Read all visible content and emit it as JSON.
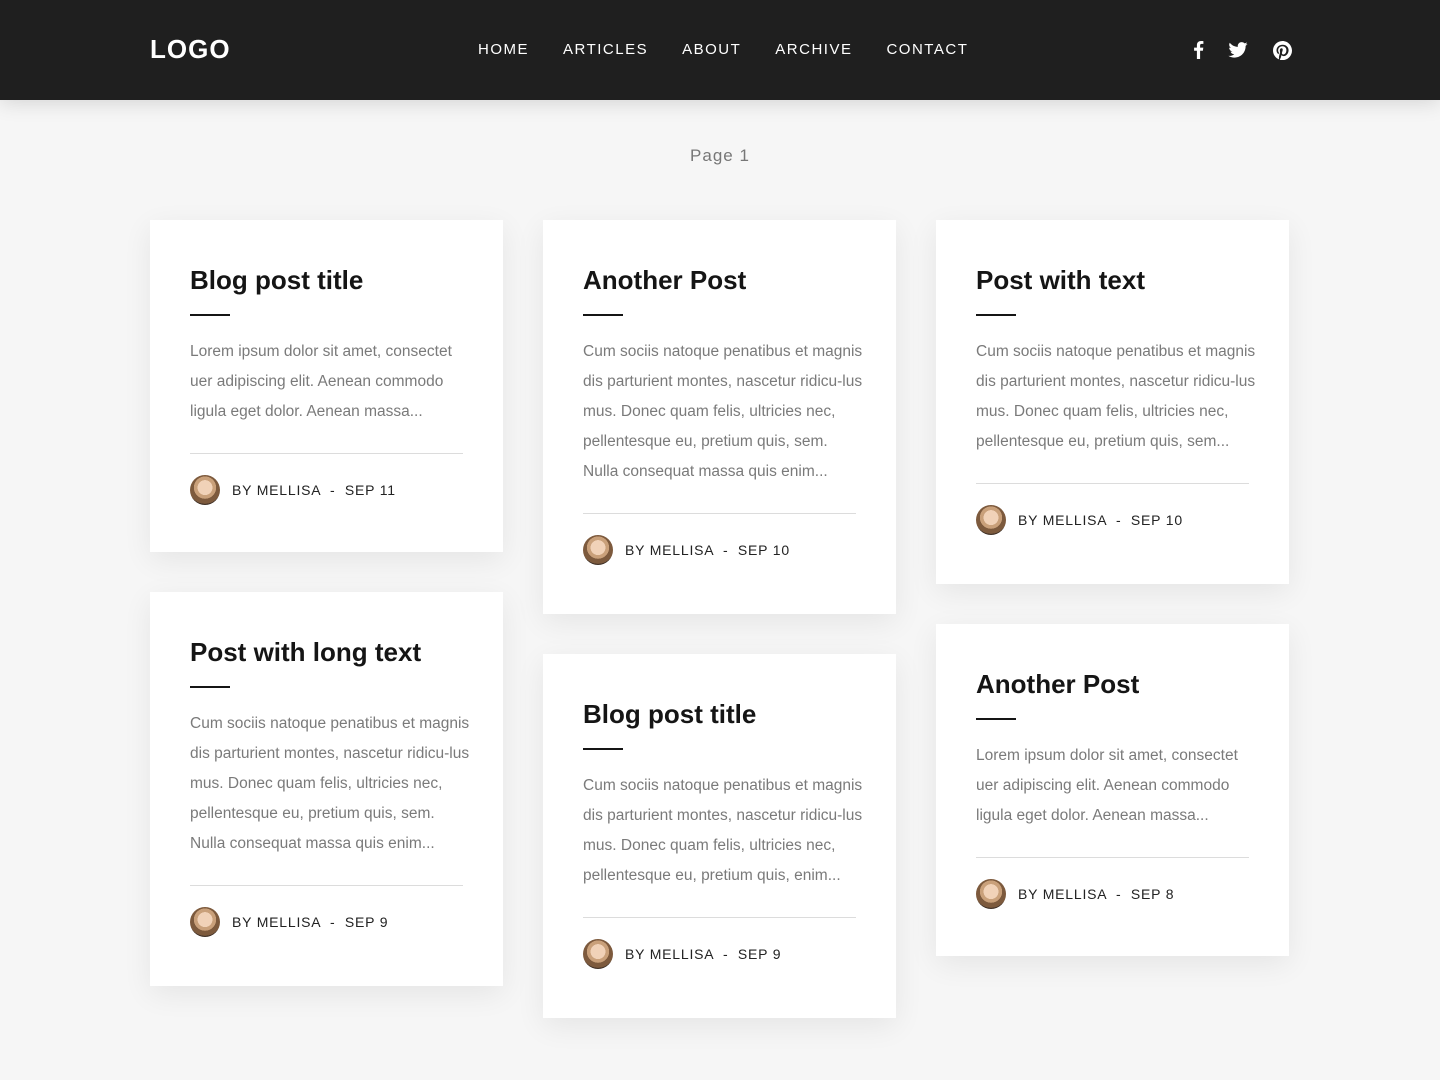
{
  "header": {
    "logo": "LOGO",
    "nav": [
      "HOME",
      "ARTICLES",
      "ABOUT",
      "ARCHIVE",
      "CONTACT"
    ],
    "social": [
      "facebook-icon",
      "twitter-icon",
      "pinterest-icon"
    ]
  },
  "page_label": "Page 1",
  "posts": [
    {
      "title": "Blog post title",
      "excerpt": "Lorem ipsum dolor sit amet, consectet uer adipiscing elit. Aenean commodo ligula eget dolor. Aenean massa...",
      "meta": "BY MELLISA  -  SEP 11"
    },
    {
      "title": "Another Post",
      "excerpt": "Cum sociis natoque penatibus et magnis dis parturient montes, nascetur ridicu-lus mus. Donec quam felis, ultricies nec, pellentesque eu, pretium quis, sem. Nulla consequat massa quis enim...",
      "meta": "BY MELLISA  -  SEP 10"
    },
    {
      "title": "Post with text",
      "excerpt": "Cum sociis natoque penatibus et magnis dis parturient montes, nascetur ridicu-lus mus. Donec quam felis, ultricies nec, pellentesque eu, pretium quis, sem...",
      "meta": "BY MELLISA  -  SEP 10"
    },
    {
      "title": "Post with long text",
      "excerpt": "Cum sociis natoque penatibus et magnis dis parturient montes, nascetur ridicu-lus mus. Donec quam felis, ultricies nec, pellentesque eu, pretium quis, sem. Nulla consequat massa quis enim...",
      "meta": "BY MELLISA  -  SEP 9"
    },
    {
      "title": "Blog post title",
      "excerpt": "Cum sociis natoque penatibus et magnis dis parturient montes, nascetur ridicu-lus mus. Donec quam felis, ultricies nec, pellentesque eu, pretium quis, enim...",
      "meta": "BY MELLISA  -  SEP 9"
    },
    {
      "title": "Another Post",
      "excerpt": "Lorem ipsum dolor sit amet, consectet uer adipiscing elit. Aenean commodo ligula eget dolor. Aenean massa...",
      "meta": "BY MELLISA  -  SEP 8"
    }
  ]
}
